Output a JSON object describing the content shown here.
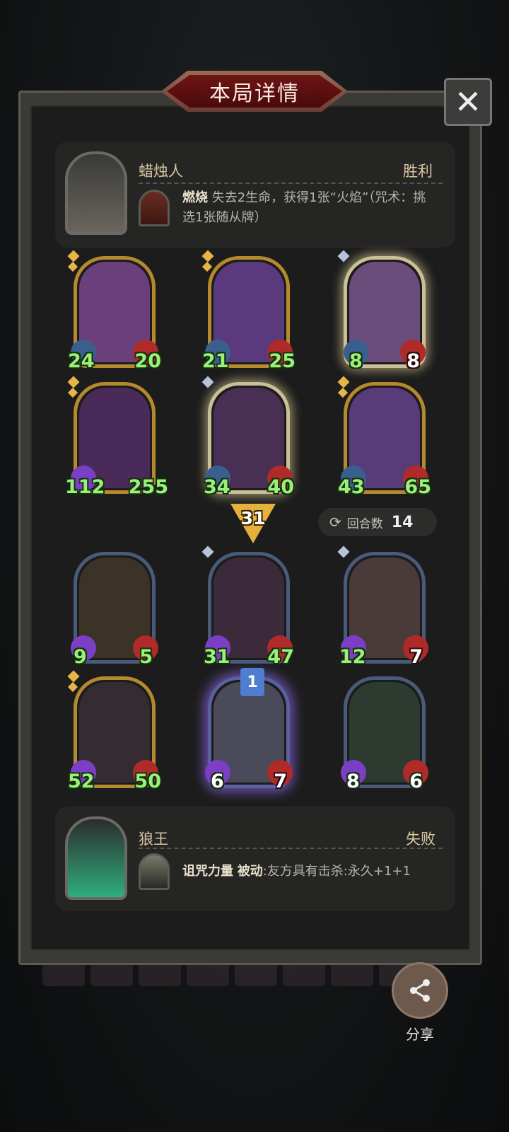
{
  "dialog": {
    "title": "本局详情",
    "close_label": "✕"
  },
  "winner": {
    "hero_name": "蜡烛人",
    "result": "胜利",
    "skill_name": "燃烧",
    "skill_desc": "失去2生命，获得1张“火焰”（咒术：挑选1张随从牌）"
  },
  "winner_board": [
    {
      "attack": "24",
      "health": "20",
      "frame": "gold",
      "art": "#6a3f7a"
    },
    {
      "attack": "21",
      "health": "25",
      "frame": "gold",
      "art": "#5a3a7d"
    },
    {
      "attack": "8",
      "health": "8",
      "frame": "glow",
      "art": "#6a4d7a"
    },
    {
      "attack": "112",
      "health": "255",
      "frame": "gold",
      "art": "#4a2a58"
    },
    {
      "attack": "34",
      "health": "40",
      "frame": "glow",
      "art": "#4a2f55"
    },
    {
      "attack": "43",
      "health": "65",
      "frame": "gold",
      "art": "#5a3b7a"
    }
  ],
  "damage": "31",
  "round": {
    "label": "回合数",
    "value": "14"
  },
  "loser_board": [
    {
      "attack": "9",
      "health": "5",
      "frame": "steel",
      "art": "#3a3326"
    },
    {
      "attack": "31",
      "health": "47",
      "frame": "steel",
      "art": "#3a2a3a"
    },
    {
      "attack": "12",
      "health": "7",
      "frame": "steel",
      "art": "#4a3a3a"
    },
    {
      "attack": "52",
      "health": "50",
      "frame": "gold",
      "art": "#352c32"
    },
    {
      "attack": "6",
      "health": "7",
      "frame": "purpleglow",
      "art": "#4a4a5a"
    },
    {
      "attack": "8",
      "health": "6",
      "frame": "steel",
      "art": "#2c3a30"
    }
  ],
  "loser_badge": "1",
  "loser": {
    "hero_name": "狼王",
    "result": "失败",
    "skill_name": "诅咒力量",
    "skill_tag": "被动",
    "skill_desc": ":友方具有击杀:永久+1+1"
  },
  "share": {
    "label": "分享"
  }
}
